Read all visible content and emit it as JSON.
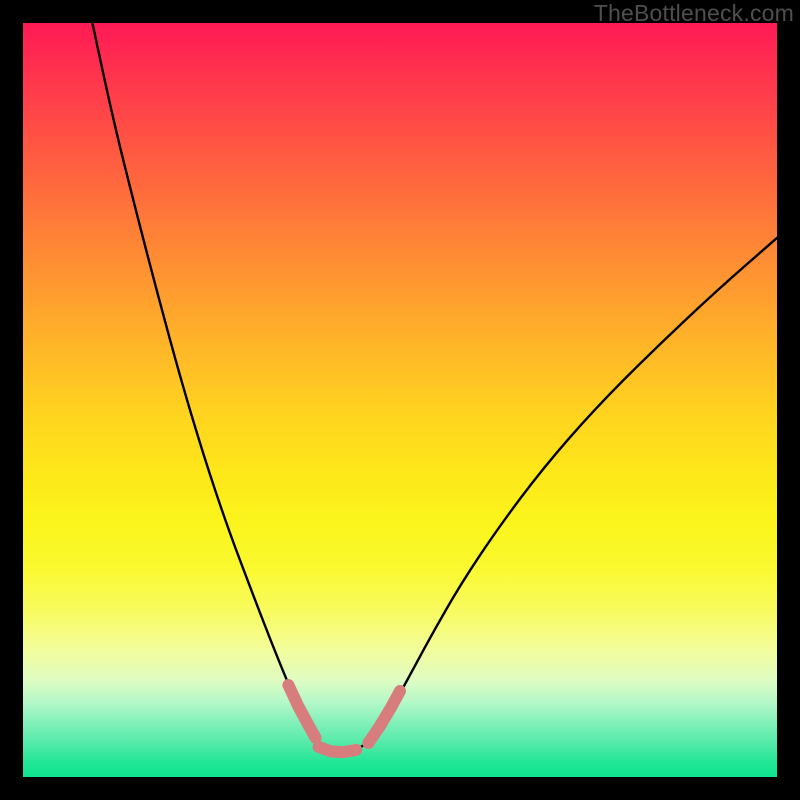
{
  "watermark": "TheBottleneck.com",
  "colors": {
    "curve_stroke": "#000000",
    "highlight_stroke": "#d77d7d",
    "background": "#000000"
  },
  "chart_data": {
    "type": "line",
    "title": "",
    "xlabel": "",
    "ylabel": "",
    "xlim": [
      0,
      100
    ],
    "ylim": [
      0,
      100
    ],
    "grid": false,
    "note": "Axes are normalized 0-100. Curve points recorded as (x_pct, y_pct) in plot-area coordinates where y=0 is top (matching the gradient direction). Bottleneck value reaches 0 (bottom) around x≈38-46.",
    "series": [
      {
        "name": "left-branch",
        "x": [
          9.2,
          12.0,
          15.0,
          18.0,
          21.0,
          24.0,
          27.0,
          30.0,
          32.5,
          34.5,
          36.2,
          37.5,
          38.5
        ],
        "y": [
          0.0,
          13.0,
          25.0,
          36.5,
          47.5,
          57.5,
          66.5,
          74.5,
          81.0,
          86.0,
          90.0,
          93.0,
          95.0
        ]
      },
      {
        "name": "valley-floor",
        "x": [
          38.5,
          40.0,
          42.0,
          44.0,
          46.0
        ],
        "y": [
          95.0,
          96.4,
          96.7,
          96.5,
          95.3
        ]
      },
      {
        "name": "right-branch",
        "x": [
          46.0,
          48.0,
          50.5,
          54.0,
          58.0,
          63.0,
          69.0,
          76.0,
          84.0,
          92.0,
          100.0
        ],
        "y": [
          95.3,
          92.5,
          88.0,
          81.5,
          74.5,
          67.0,
          59.0,
          51.0,
          43.0,
          35.5,
          28.5
        ]
      }
    ],
    "highlight_segments": [
      {
        "name": "left-highlight",
        "x": [
          35.2,
          36.5,
          37.8,
          38.8
        ],
        "y": [
          87.8,
          90.6,
          93.0,
          94.8
        ]
      },
      {
        "name": "bottom-highlight",
        "x": [
          39.2,
          40.8,
          42.5,
          44.2
        ],
        "y": [
          96.0,
          96.6,
          96.7,
          96.4
        ]
      },
      {
        "name": "right-highlight",
        "x": [
          45.8,
          47.3,
          48.8,
          50.0
        ],
        "y": [
          95.5,
          93.3,
          90.8,
          88.6
        ]
      }
    ]
  }
}
